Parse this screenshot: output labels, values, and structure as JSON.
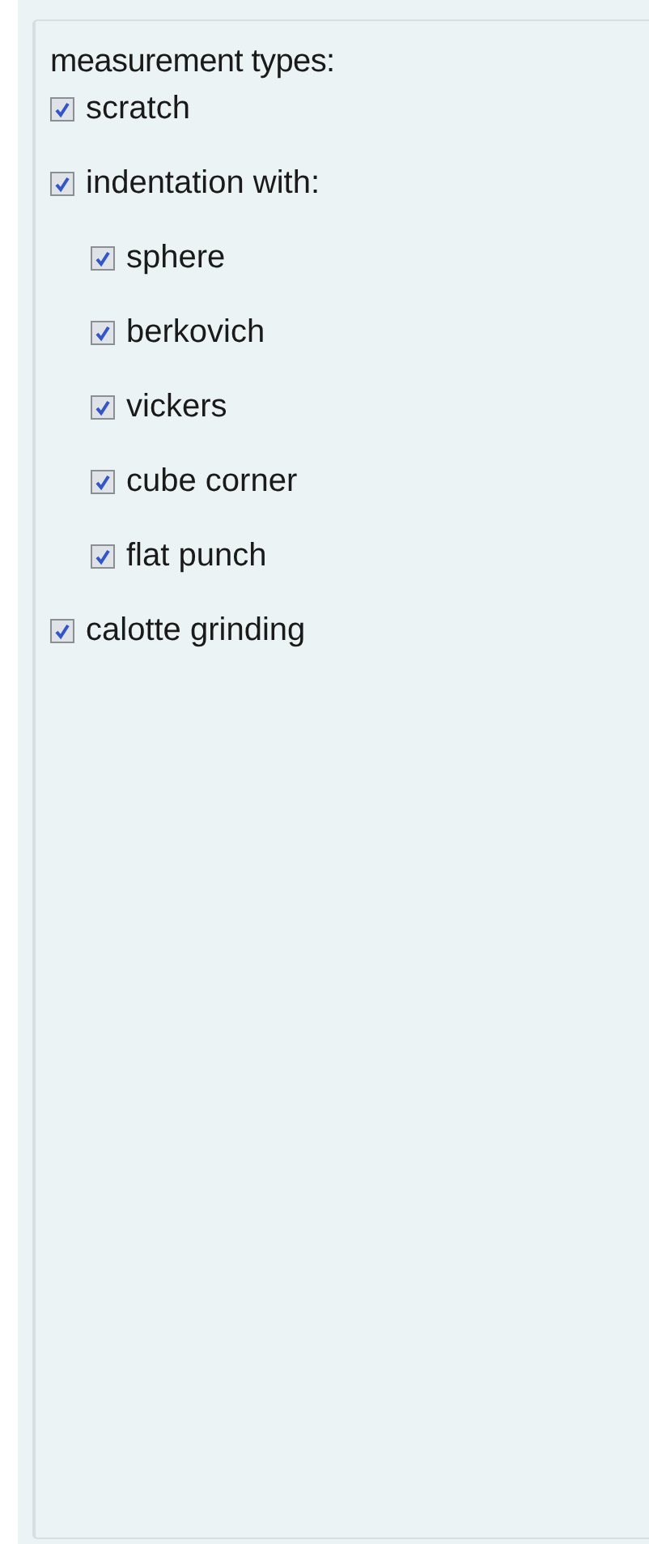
{
  "panel": {
    "title": "measurement types:",
    "items": [
      {
        "label": "scratch",
        "checked": true
      },
      {
        "label": "indentation with:",
        "checked": true,
        "children": [
          {
            "label": "sphere",
            "checked": true
          },
          {
            "label": "berkovich",
            "checked": true
          },
          {
            "label": "vickers",
            "checked": true
          },
          {
            "label": "cube corner",
            "checked": true
          },
          {
            "label": "flat punch",
            "checked": true
          }
        ]
      },
      {
        "label": "calotte grinding",
        "checked": true
      }
    ]
  }
}
